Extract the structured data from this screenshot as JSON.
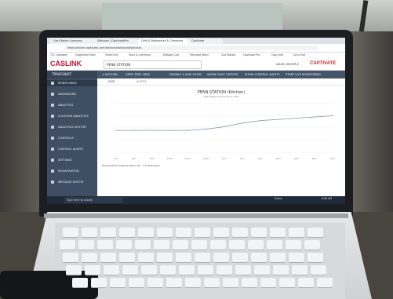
{
  "browser": {
    "tabs": [
      "Gas Station Company",
      "Statuses | CaptivatePro",
      "Cafe & Bookmarks & Commons",
      "Captivate"
    ],
    "url": "https://travel.captivate.com/station/dashboard/statuses",
    "bookmarks": [
      "TCC Goodway",
      "Suggested Sites",
      "Travel Info",
      "Tools & Commons",
      "Mileage Calc",
      "Microsoft Word",
      "Gas Station",
      "Captivate Pro",
      "Copy Info",
      "Go to live"
    ]
  },
  "app": {
    "logo": "CASLINK",
    "station": "PENN STATION",
    "header_right": "#ASK VISITOR ▾",
    "captivate": "CAPTIVATE",
    "sidebar_title": "TRAVELNUFF",
    "sidebar_items": [
      "MONITORING",
      "DASHBOARD",
      "ANALYTICS",
      "LOCATION ANALYTICS",
      "ANALYTICS HISTORY",
      "CONTROLS",
      "CONTROL AUDITS",
      "SETTINGS",
      "REGISTRATION",
      "MESSAGE EDITOR"
    ],
    "toolbar": [
      "< KITCHEN",
      "OPEN TREE VIEW",
      "DISABLE 4 AXIS ZOOM",
      "SHOW FAULT HISTORY",
      "SHOW CONTROL AUDITS",
      "START LIVE MONITORING"
    ],
    "subtabs": [
      "DATA",
      "ALERTS"
    ],
    "chart_title": "PENN STATION (Kitchen)",
    "chart_subtitle": "Aggregated temperature data",
    "legend": "Temperature (Celsius) Station 47 - CT 2018-2019",
    "taskbar_search": "Type here to search",
    "tray": [
      "Sunny",
      "8:46 AM"
    ]
  },
  "chart_data": {
    "type": "line",
    "title": "PENN STATION (Kitchen)",
    "x": [
      "7am",
      "8am",
      "9am",
      "10am",
      "11am",
      "12pm",
      "1pm",
      "2pm",
      "3pm",
      "4pm",
      "5pm",
      "6pm",
      "7pm"
    ],
    "series": [
      {
        "values": [
          29.8,
          29.8,
          29.8,
          29.8,
          29.8,
          29.9,
          30.1,
          30.4,
          30.6,
          30.7,
          30.8,
          30.9,
          31.0
        ]
      }
    ],
    "ylim": [
      28,
      32
    ],
    "grid": true
  }
}
